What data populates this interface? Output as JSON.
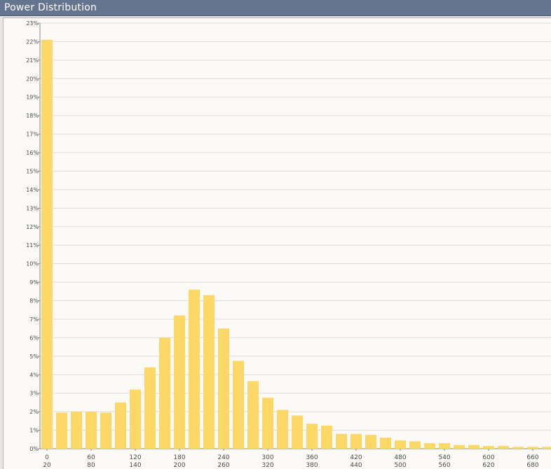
{
  "window": {
    "title": "Power Distribution"
  },
  "chart_data": {
    "type": "bar",
    "title": "",
    "xlabel": "",
    "ylabel": "",
    "ylim": [
      0,
      23
    ],
    "ytick_labels": [
      "0%",
      "1%",
      "2%",
      "3%",
      "4%",
      "5%",
      "6%",
      "7%",
      "8%",
      "9%",
      "10%",
      "11%",
      "12%",
      "13%",
      "14%",
      "15%",
      "16%",
      "17%",
      "18%",
      "19%",
      "20%",
      "21%",
      "22%",
      "23%"
    ],
    "xtick_labels_top": [
      "0",
      "60",
      "120",
      "180",
      "240",
      "300",
      "360",
      "420",
      "480",
      "540",
      "600",
      "660"
    ],
    "xtick_labels_bottom": [
      "20",
      "80",
      "140",
      "200",
      "260",
      "320",
      "380",
      "440",
      "500",
      "560",
      "620",
      "680"
    ],
    "categories": [
      "0",
      "20",
      "40",
      "60",
      "80",
      "100",
      "120",
      "140",
      "160",
      "180",
      "200",
      "220",
      "240",
      "260",
      "280",
      "300",
      "320",
      "340",
      "360",
      "380",
      "400",
      "420",
      "440",
      "460",
      "480",
      "500",
      "520",
      "540",
      "560",
      "580",
      "600",
      "620",
      "640",
      "660",
      "680",
      "700"
    ],
    "values": [
      22.1,
      1.95,
      2.0,
      2.0,
      1.95,
      2.5,
      3.2,
      4.4,
      6.0,
      7.2,
      8.6,
      8.3,
      6.5,
      4.75,
      3.65,
      2.75,
      2.1,
      1.8,
      1.35,
      1.25,
      0.8,
      0.8,
      0.75,
      0.6,
      0.45,
      0.4,
      0.3,
      0.3,
      0.2,
      0.2,
      0.15,
      0.15,
      0.1,
      0.1,
      0.1,
      0.1
    ],
    "grid": true,
    "colors": {
      "bar": "#fcd966",
      "grid": "#dcdcdc",
      "axis": "#8a8a8a"
    }
  }
}
